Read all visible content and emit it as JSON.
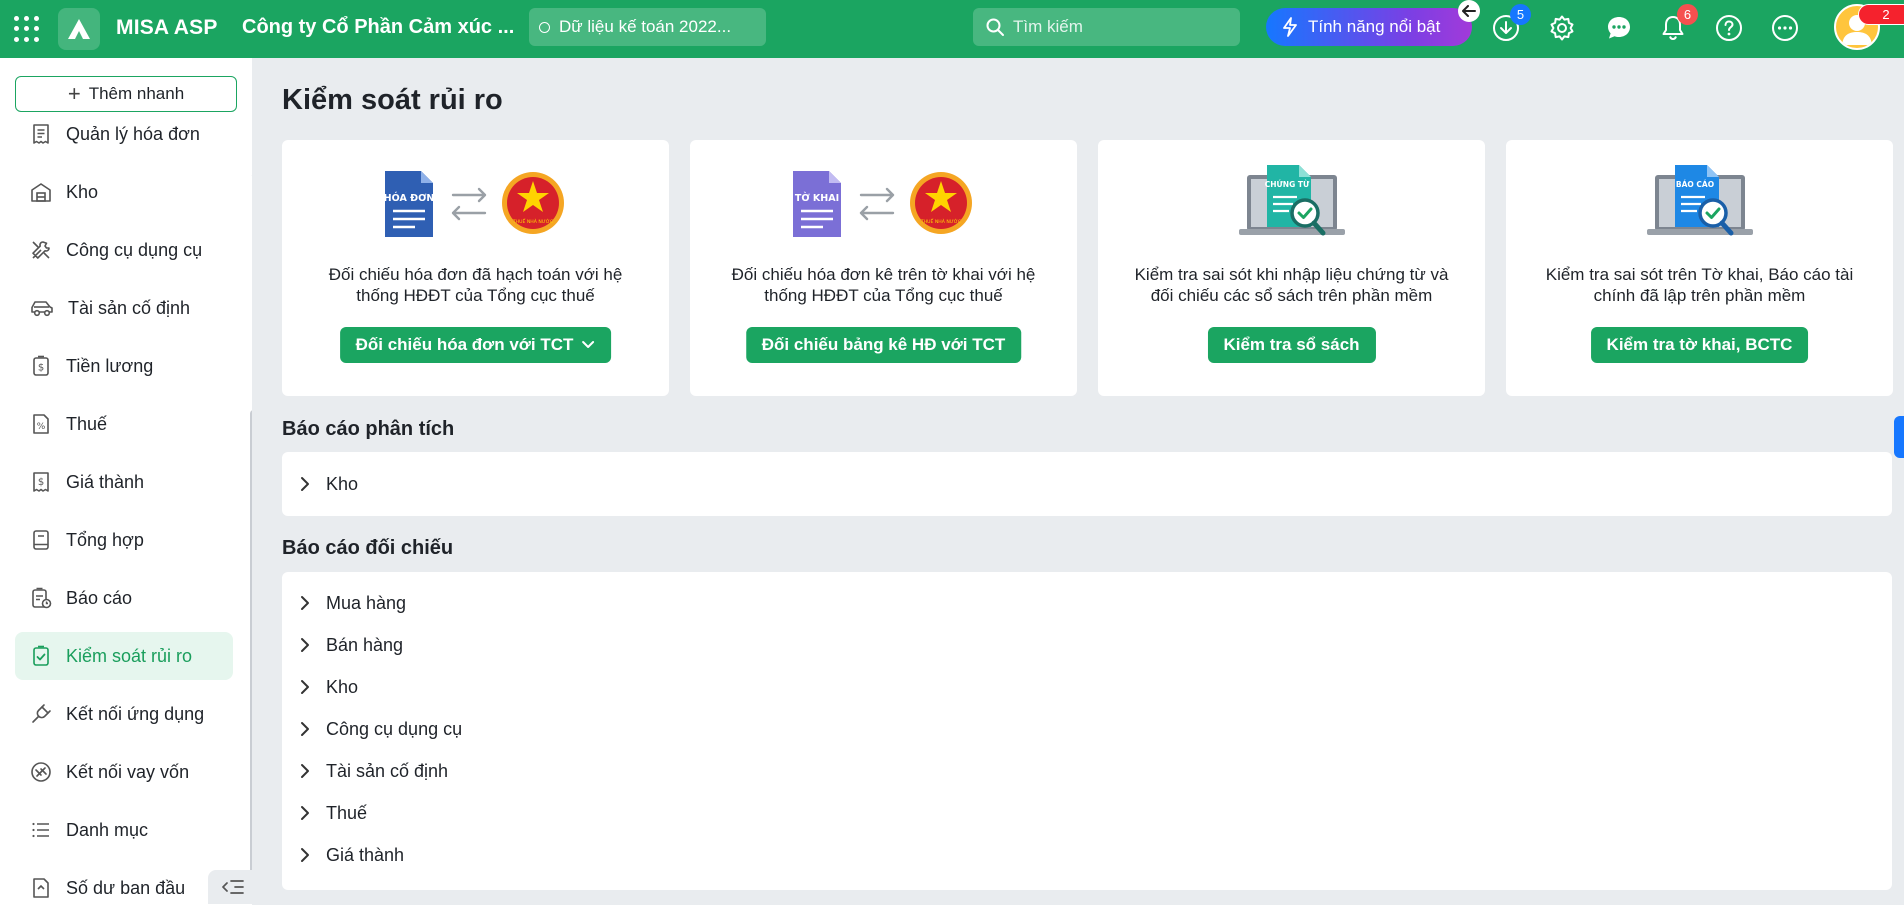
{
  "topbar": {
    "brand": "MISA ASP",
    "company": "Công ty Cổ Phần Cảm xúc ...",
    "dataset": "Dữ liệu kế toán 2022...",
    "search_placeholder": "Tìm kiếm",
    "feature_button": "Tính năng nổi bật",
    "download_badge": "5",
    "notification_badge": "6",
    "avatar_badge": "2",
    "colors": {
      "bar": "#1ba561",
      "download_badge": "#1677ff",
      "notification_badge": "#f5504f",
      "avatar_badge": "#f5222d"
    }
  },
  "sidebar": {
    "quick_add": "Thêm nhanh",
    "items": [
      {
        "label": "Quản lý hóa đơn",
        "icon": "receipt-icon"
      },
      {
        "label": "Kho",
        "icon": "warehouse-icon"
      },
      {
        "label": "Công cụ dụng cụ",
        "icon": "tools-icon"
      },
      {
        "label": "Tài sản cố định",
        "icon": "car-icon"
      },
      {
        "label": "Tiền lương",
        "icon": "salary-icon"
      },
      {
        "label": "Thuế",
        "icon": "tax-icon"
      },
      {
        "label": "Giá thành",
        "icon": "price-icon"
      },
      {
        "label": "Tổng hợp",
        "icon": "book-icon"
      },
      {
        "label": "Báo cáo",
        "icon": "report-icon"
      },
      {
        "label": "Kiểm soát rủi ro",
        "icon": "risk-check-icon",
        "active": true
      },
      {
        "label": "Kết nối ứng dụng",
        "icon": "plug-icon"
      },
      {
        "label": "Kết nối vay vốn",
        "icon": "loan-icon"
      },
      {
        "label": "Danh mục",
        "icon": "list-icon"
      },
      {
        "label": "Số dư ban đầu",
        "icon": "balance-icon"
      }
    ]
  },
  "main": {
    "title": "Kiểm soát rủi ro",
    "cards": [
      {
        "doc_label": "HÓA ĐƠN",
        "seal_label": "THUẾ NHÀ NƯỚC",
        "desc_line1": "Đối chiếu hóa đơn đã hạch toán với hệ",
        "desc_line2": "thống HĐĐT của Tổng cục thuế",
        "button": "Đối chiếu hóa đơn với TCT"
      },
      {
        "doc_label": "TỜ KHAI",
        "seal_label": "THUẾ NHÀ NƯỚC",
        "desc_line1": "Đối chiếu hóa đơn kê trên tờ khai với hệ",
        "desc_line2": "thống HĐĐT của Tổng cục thuế",
        "button": "Đối chiếu bảng kê HĐ với TCT"
      },
      {
        "doc_label": "CHỨNG TỪ",
        "desc_line1": "Kiểm tra sai sót khi nhập liệu chứng từ và",
        "desc_line2": "đối chiếu các sổ sách trên phần mềm",
        "button": "Kiểm tra sổ sách"
      },
      {
        "doc_label": "BÁO CÁO",
        "desc_line1": "Kiểm tra sai sót trên Tờ khai, Báo cáo tài",
        "desc_line2": "chính đã lập trên phần mềm",
        "button": "Kiểm tra tờ khai, BCTC"
      }
    ],
    "analysis": {
      "title": "Báo cáo phân tích",
      "rows": [
        "Kho"
      ]
    },
    "reconcile": {
      "title": "Báo cáo đối chiếu",
      "rows": [
        "Mua hàng",
        "Bán hàng",
        "Kho",
        "Công cụ dụng cụ",
        "Tài sản cố định",
        "Thuế",
        "Giá thành"
      ]
    }
  }
}
